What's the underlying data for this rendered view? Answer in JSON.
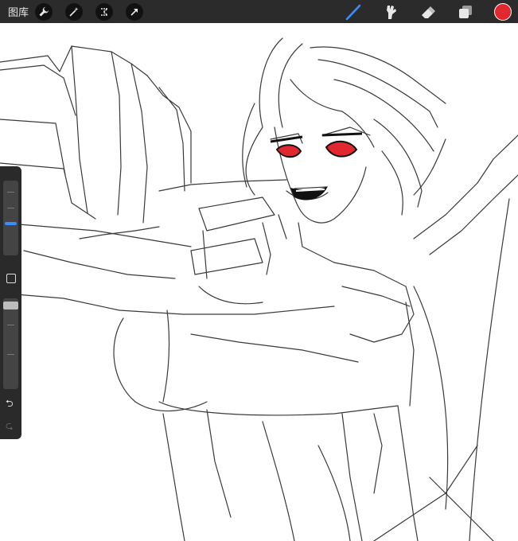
{
  "topbar": {
    "gallery_label": "图库",
    "left_tools": [
      "wrench-icon",
      "magic-wand-icon",
      "selection-icon",
      "transform-arrow-icon"
    ],
    "right_tools": [
      "brush-icon",
      "smudge-icon",
      "eraser-icon",
      "layers-icon"
    ],
    "active_tool": "brush-icon",
    "active_color": "#e0282e"
  },
  "sidebar": {
    "brush_size_label": "",
    "opacity_label": "",
    "undo_glyph": "⮌",
    "redo_glyph": "⮎"
  },
  "colors": {
    "bar": "#2b2b2b",
    "accent": "#3a8dff",
    "eye": "#e0282e"
  }
}
